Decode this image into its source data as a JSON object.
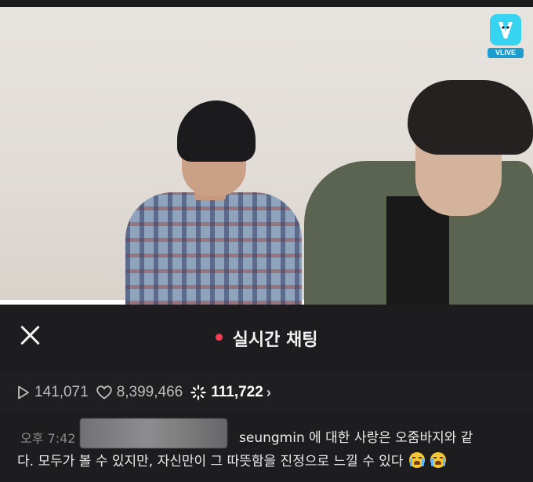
{
  "video": {
    "logo_text": "VLIVE"
  },
  "chat_header": {
    "title": "실시간 채팅",
    "live_color": "#ff3b55"
  },
  "stats": {
    "plays": "141,071",
    "likes": "8,399,466",
    "hot": "111,722",
    "play_icon": "play-icon",
    "heart_icon": "heart-icon",
    "sparkle_icon": "sparkle-icon",
    "chevron_icon": "chevron-right-icon"
  },
  "message": {
    "time": "오후 7:42",
    "text_line1": "seungmin 에 대한 사랑은 오줌바지와 같",
    "text_line2": "다. 모두가 볼 수 있지만, 자신만이 그 따뜻함을 진정으로 느낄 수 있다",
    "emoji_icon": "crying-face-icon"
  },
  "colors": {
    "background": "#1d1d1f",
    "vlive_brand": "#36d4f0"
  }
}
